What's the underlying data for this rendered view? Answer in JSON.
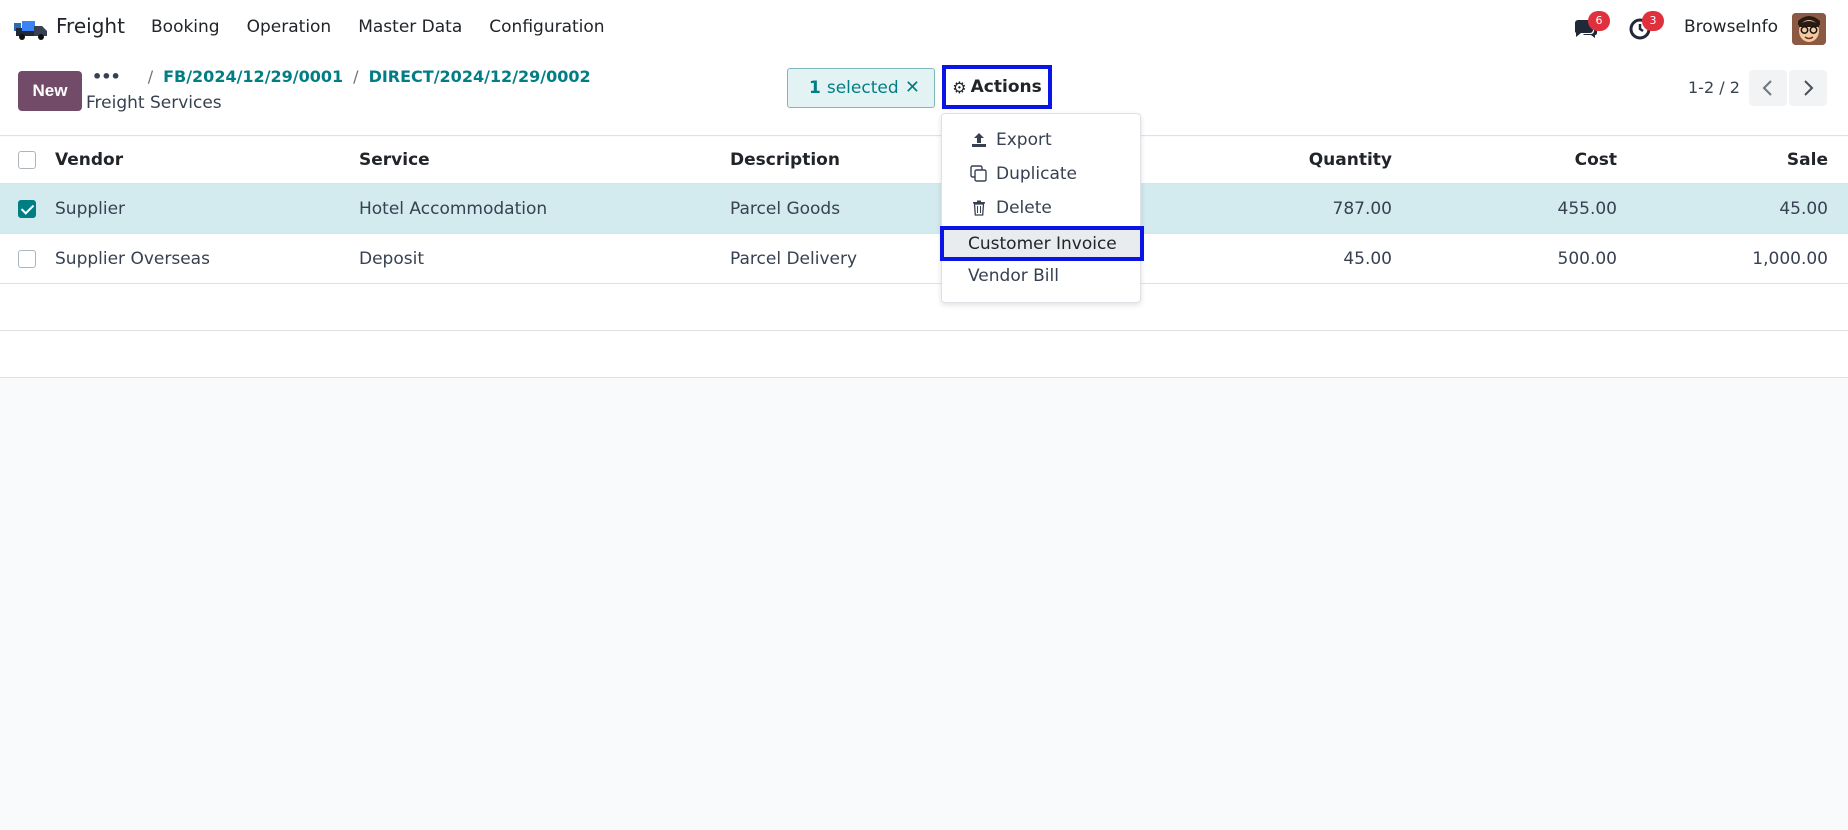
{
  "navbar": {
    "app_name": "Freight",
    "menu": [
      "Booking",
      "Operation",
      "Master Data",
      "Configuration"
    ],
    "chat_count": "6",
    "activity_count": "3",
    "company": "BrowseInfo"
  },
  "control": {
    "new_label": "New",
    "breadcrumb_more": "•••",
    "breadcrumbs": [
      "FB/2024/12/29/0001",
      "DIRECT/2024/12/29/0002"
    ],
    "breadcrumb_sep": "/",
    "title": "Freight Services",
    "selected_count": "1",
    "selected_label": "selected",
    "clear_icon": "✕",
    "actions_label": "Actions",
    "pager": "1-2 / 2"
  },
  "table": {
    "headers": {
      "vendor": "Vendor",
      "service": "Service",
      "description": "Description",
      "quantity": "Quantity",
      "cost": "Cost",
      "sale": "Sale"
    },
    "rows": [
      {
        "vendor": "Supplier",
        "service": "Hotel Accommodation",
        "description": "Parcel Goods",
        "quantity": "787.00",
        "cost": "455.00",
        "sale": "45.00",
        "selected": true
      },
      {
        "vendor": "Supplier Overseas",
        "service": "Deposit",
        "description": "Parcel Delivery",
        "quantity": "45.00",
        "cost": "500.00",
        "sale": "1,000.00",
        "selected": false
      }
    ]
  },
  "actions_menu": {
    "export": "Export",
    "duplicate": "Duplicate",
    "delete": "Delete",
    "customer_invoice": "Customer Invoice",
    "vendor_bill": "Vendor Bill"
  },
  "colors": {
    "brand": "#714b67",
    "link": "#017e84",
    "highlight": "#0a14e6",
    "badge": "#e0303d"
  },
  "icons": [
    "truck-logo-icon",
    "chat-icon",
    "activity-clock-icon",
    "gear-icon",
    "upload-icon",
    "copy-icon",
    "trash-icon",
    "chevron-left-icon",
    "chevron-right-icon"
  ]
}
